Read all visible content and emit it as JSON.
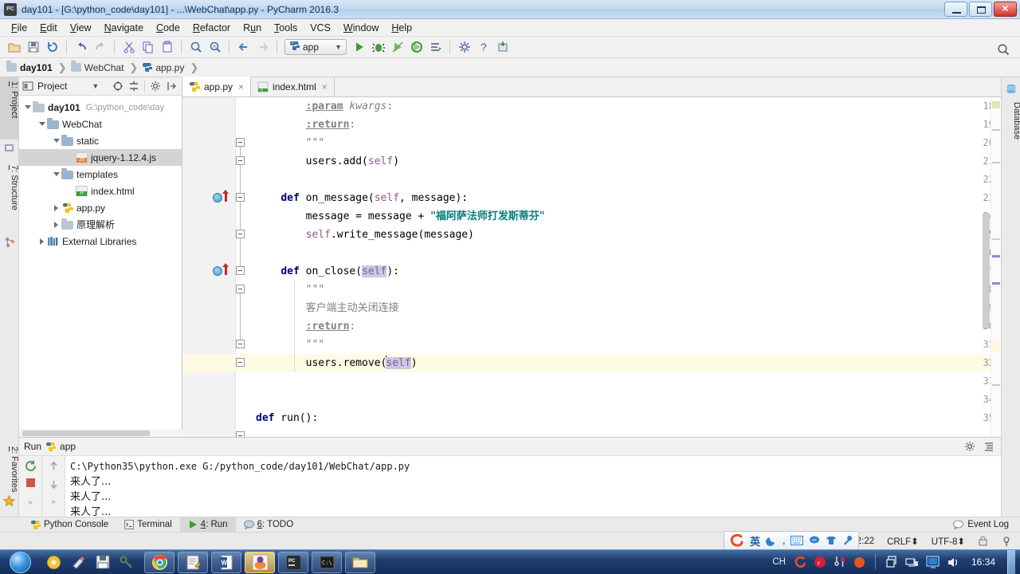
{
  "window": {
    "title": "day101 - [G:\\python_code\\day101] - ...\\WebChat\\app.py - PyCharm 2016.3",
    "app_icon": "pycharm-icon",
    "minimize_label": "Minimize",
    "maximize_label": "Maximize",
    "close_label": "Close"
  },
  "menubar": {
    "items": [
      {
        "label": "File",
        "mnemonic": "F"
      },
      {
        "label": "Edit",
        "mnemonic": "E"
      },
      {
        "label": "View",
        "mnemonic": "V"
      },
      {
        "label": "Navigate",
        "mnemonic": "N"
      },
      {
        "label": "Code",
        "mnemonic": "C"
      },
      {
        "label": "Refactor",
        "mnemonic": "R"
      },
      {
        "label": "Run",
        "mnemonic": "u"
      },
      {
        "label": "Tools",
        "mnemonic": "T"
      },
      {
        "label": "VCS",
        "mnemonic": ""
      },
      {
        "label": "Window",
        "mnemonic": "W"
      },
      {
        "label": "Help",
        "mnemonic": "H"
      }
    ]
  },
  "toolbar": {
    "buttons": [
      {
        "name": "open-icon",
        "tooltip": "Open"
      },
      {
        "name": "save-all-icon",
        "tooltip": "Save All"
      },
      {
        "name": "sync-icon",
        "tooltip": "Synchronize"
      },
      {
        "name": "undo-icon",
        "tooltip": "Undo"
      },
      {
        "name": "redo-icon",
        "tooltip": "Redo"
      },
      {
        "name": "cut-icon",
        "tooltip": "Cut"
      },
      {
        "name": "copy-icon",
        "tooltip": "Copy"
      },
      {
        "name": "paste-icon",
        "tooltip": "Paste"
      },
      {
        "name": "find-icon",
        "tooltip": "Find"
      },
      {
        "name": "replace-icon",
        "tooltip": "Replace"
      },
      {
        "name": "back-icon",
        "tooltip": "Back"
      },
      {
        "name": "forward-icon",
        "tooltip": "Forward"
      }
    ],
    "run_config": {
      "label": "app",
      "icon": "python-icon",
      "dropdown": "▾"
    },
    "run_buttons": [
      {
        "name": "run-icon",
        "tooltip": "Run"
      },
      {
        "name": "debug-icon",
        "tooltip": "Debug"
      },
      {
        "name": "coverage-icon",
        "tooltip": "Run with Coverage"
      },
      {
        "name": "profile-icon",
        "tooltip": "Profile"
      },
      {
        "name": "attach-icon",
        "tooltip": "Attach to Process"
      }
    ],
    "extra_buttons": [
      {
        "name": "settings-icon",
        "tooltip": "Settings"
      },
      {
        "name": "help-icon",
        "tooltip": "Help"
      },
      {
        "name": "update-icon",
        "tooltip": "Update"
      }
    ],
    "search_icon": "search-everywhere-icon"
  },
  "breadcrumb": {
    "items": [
      {
        "label": "day101",
        "icon": "folder-icon",
        "bold": true
      },
      {
        "label": "WebChat",
        "icon": "folder-icon",
        "bold": false
      },
      {
        "label": "app.py",
        "icon": "python-icon",
        "bold": false
      }
    ],
    "separator": "❯"
  },
  "left_rail": {
    "tabs": [
      {
        "label": "1: Project",
        "mnemonic": "1",
        "active": true,
        "icon": "project-icon"
      },
      {
        "label": "7: Structure",
        "mnemonic": "7",
        "active": false,
        "icon": "structure-icon"
      },
      {
        "label": "2: Favorites",
        "mnemonic": "2",
        "active": false,
        "icon": "star-icon"
      }
    ]
  },
  "right_rail": {
    "tabs": [
      {
        "label": "Database",
        "icon": "database-icon"
      }
    ]
  },
  "project_panel": {
    "title": "Project",
    "dropdown_icon": "chevron-down-icon",
    "tools": [
      "target-icon",
      "collapse-all-icon",
      "gear-icon",
      "hide-icon"
    ],
    "tree": [
      {
        "label": "day101",
        "path": "G:\\python_code\\day",
        "icon": "folder-icon",
        "depth": 0,
        "expanded": true,
        "bold": true,
        "selected": false
      },
      {
        "label": "WebChat",
        "path": "",
        "icon": "folder-src-icon",
        "depth": 1,
        "expanded": true,
        "bold": false,
        "selected": false
      },
      {
        "label": "static",
        "path": "",
        "icon": "folder-src-icon",
        "depth": 2,
        "expanded": true,
        "bold": false,
        "selected": false
      },
      {
        "label": "jquery-1.12.4.js",
        "path": "",
        "icon": "js-file-icon",
        "depth": 3,
        "expanded": null,
        "bold": false,
        "selected": true
      },
      {
        "label": "templates",
        "path": "",
        "icon": "folder-src-icon",
        "depth": 2,
        "expanded": true,
        "bold": false,
        "selected": false
      },
      {
        "label": "index.html",
        "path": "",
        "icon": "html-file-icon",
        "depth": 3,
        "expanded": null,
        "bold": false,
        "selected": false
      },
      {
        "label": "app.py",
        "path": "",
        "icon": "python-file-icon",
        "depth": 2,
        "expanded": false,
        "bold": false,
        "selected": false
      },
      {
        "label": "原理解析",
        "path": "",
        "icon": "folder-icon",
        "depth": 2,
        "expanded": false,
        "bold": false,
        "selected": false
      },
      {
        "label": "External Libraries",
        "path": "",
        "icon": "library-icon",
        "depth": 1,
        "expanded": false,
        "bold": false,
        "selected": false
      }
    ]
  },
  "editor": {
    "tabs": [
      {
        "label": "app.py",
        "icon": "python-file-icon",
        "active": true,
        "close": "×"
      },
      {
        "label": "index.html",
        "icon": "html-file-icon",
        "active": false,
        "close": "×"
      }
    ],
    "first_line_number": 18,
    "highlighted_line": 32,
    "lines": [
      {
        "n": 18,
        "text": "        :param kwargs:"
      },
      {
        "n": 19,
        "text": "        :return:"
      },
      {
        "n": 20,
        "text": "        \"\"\""
      },
      {
        "n": 21,
        "text": "        users.add(self)"
      },
      {
        "n": 22,
        "text": ""
      },
      {
        "n": 23,
        "text": "    def on_message(self, message):"
      },
      {
        "n": 24,
        "text": "        message = message + \"福阿萨法师打发斯蒂芬\""
      },
      {
        "n": 25,
        "text": "        self.write_message(message)"
      },
      {
        "n": 26,
        "text": ""
      },
      {
        "n": 27,
        "text": "    def on_close(self):"
      },
      {
        "n": 28,
        "text": "        \"\"\""
      },
      {
        "n": 29,
        "text": "        客户端主动关闭连接"
      },
      {
        "n": 30,
        "text": "        :return:"
      },
      {
        "n": 31,
        "text": "        \"\"\""
      },
      {
        "n": 32,
        "text": "        users.remove(self)"
      },
      {
        "n": 33,
        "text": ""
      },
      {
        "n": 34,
        "text": ""
      },
      {
        "n": 35,
        "text": "def run():"
      }
    ],
    "breakpoint_lines": [
      23,
      27
    ]
  },
  "run_panel": {
    "title": "Run",
    "config_name": "app",
    "config_icon": "python-icon",
    "tools": [
      "gear-icon",
      "hide-panel-icon"
    ],
    "left_buttons": [
      "rerun-icon",
      "stop-icon",
      "expand-icon"
    ],
    "nav_buttons": [
      "up-icon",
      "down-icon",
      "soft-wrap-icon"
    ],
    "console_lines": [
      {
        "text": "C:\\Python35\\python.exe G:/python_code/day101/WebChat/app.py",
        "cjk": false
      },
      {
        "text": "来人了...",
        "cjk": true
      },
      {
        "text": "来人了...",
        "cjk": true
      },
      {
        "text": "来人了...",
        "cjk": true
      }
    ]
  },
  "toolwindow_bar": {
    "items": [
      {
        "label": "Python Console",
        "mnemonic": "",
        "icon": "python-icon",
        "active": false
      },
      {
        "label": "Terminal",
        "mnemonic": "",
        "icon": "terminal-icon",
        "active": false
      },
      {
        "label": "4: Run",
        "mnemonic": "4",
        "icon": "run-icon",
        "active": true
      },
      {
        "label": "6: TODO",
        "mnemonic": "6",
        "icon": "todo-icon",
        "active": false
      }
    ],
    "event_log": {
      "label": "Event Log",
      "icon": "balloon-icon"
    }
  },
  "statusbar": {
    "caret_position": "32:22",
    "line_separator": "CRLF⬍",
    "encoding": "UTF-8⬍",
    "lock_icon": "write-lock-icon",
    "inspection_icon": "inspection-icon"
  },
  "ime_bar": {
    "logo": "sogou-icon",
    "mode": "英",
    "buttons": [
      "moon-icon",
      "comma-icon",
      "keyboard-icon",
      "speech-icon",
      "skin-icon",
      "toolbox-icon"
    ]
  },
  "taskbar": {
    "start_label": "Start",
    "quick_launch": [
      {
        "name": "media-player-icon"
      },
      {
        "name": "paint-icon"
      },
      {
        "name": "save-icon"
      },
      {
        "name": "key-icon"
      }
    ],
    "apps": [
      {
        "name": "chrome-window",
        "active": false
      },
      {
        "name": "notepad-window",
        "active": false
      },
      {
        "name": "word-window",
        "active": false
      },
      {
        "name": "pycharm-window",
        "active": true
      },
      {
        "name": "pycharm-window-2",
        "active": false
      },
      {
        "name": "cmd-window",
        "active": false
      },
      {
        "name": "explorer-window",
        "active": false
      }
    ],
    "tray": {
      "language": "CH",
      "icons": [
        "sogou-icon",
        "antivirus-icon",
        "tool-icon",
        "circle-icon",
        "share-icon",
        "network-icon",
        "monitor-icon",
        "volume-icon"
      ],
      "clock": "16:34"
    }
  },
  "colors": {
    "accent": "#3a6ea5",
    "keyword": "#000080",
    "string": "#008080",
    "self": "#94558d",
    "comment": "#808080",
    "highlight_line": "#fffae3",
    "selection": "#c5cae9"
  }
}
